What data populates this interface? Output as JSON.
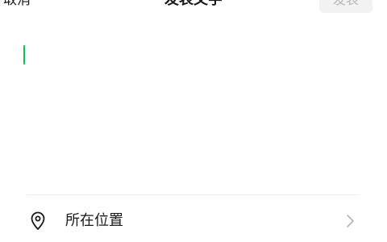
{
  "header": {
    "cancel_label": "取消",
    "title": "发表文字",
    "publish_label": "发表"
  },
  "compose": {
    "text": ""
  },
  "location": {
    "label": "所在位置",
    "icon": "location-pin-icon",
    "arrow_icon": "chevron-right-icon"
  },
  "colors": {
    "accent": "#07c160",
    "publish_disabled_bg": "#f2f2f2",
    "publish_disabled_text": "#b8b8b8"
  }
}
